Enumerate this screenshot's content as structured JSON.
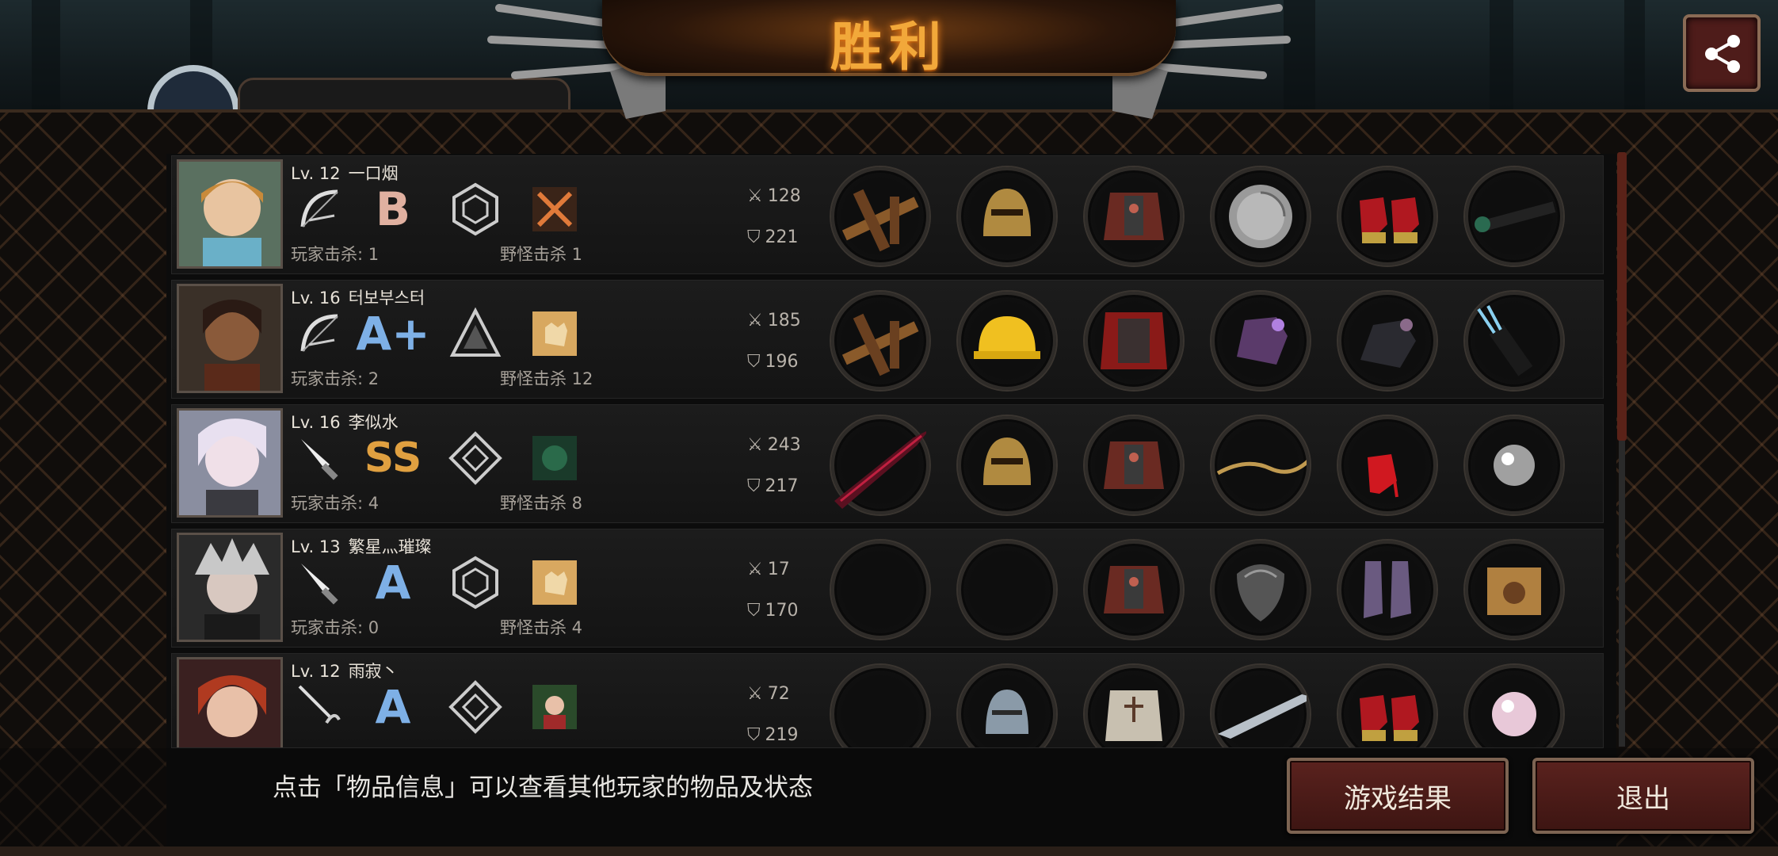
{
  "title": "胜利",
  "tip": "点击「物品信息」可以查看其他玩家的物品及状态",
  "buttons": {
    "game_result": "游戏结果",
    "exit": "退出"
  },
  "share_icon": "share-icon",
  "colors": {
    "title": "#f2a83a",
    "button_bg": "#4a1a17",
    "grade_gold": "#e0a040",
    "grade_blue": "#7eb0e6"
  },
  "players": [
    {
      "level": "Lv. 12",
      "name": "一口烟",
      "weapon_icon": "bow-icon",
      "grade": "B",
      "role_icon": "hexagon-emblem-icon",
      "skill_icon": "crossed-swords-skill-icon",
      "player_kills": "玩家击杀: 1",
      "monster_kills": "野怪击杀 1",
      "attack": "128",
      "defense": "221",
      "equipment": [
        "crossbow-icon",
        "gold-knight-helmet-icon",
        "red-plate-armor-icon",
        "silver-disc-icon",
        "red-heels-icon",
        "scope-icon"
      ]
    },
    {
      "level": "Lv. 16",
      "name": "터보부스터",
      "weapon_icon": "bow-icon",
      "grade": "A+",
      "role_icon": "triangle-emblem-icon",
      "skill_icon": "hand-skill-icon",
      "player_kills": "玩家击杀: 2",
      "monster_kills": "野怪击杀 12",
      "attack": "185",
      "defense": "196",
      "equipment": [
        "crossbow-icon",
        "hard-hat-icon",
        "red-cape-armor-icon",
        "purple-gauntlet-icon",
        "dark-gauntlet-icon",
        "quiver-icon"
      ]
    },
    {
      "level": "Lv. 16",
      "name": "李似水",
      "weapon_icon": "knife-icon",
      "grade": "SS",
      "role_icon": "diamond-emblem-icon",
      "skill_icon": "forest-skill-icon",
      "player_kills": "玩家击杀: 4",
      "monster_kills": "野怪击杀 8",
      "attack": "243",
      "defense": "217",
      "equipment": [
        "crimson-blade-icon",
        "gold-knight-helmet-icon",
        "red-plate-armor-icon",
        "golden-vine-icon",
        "red-heels-icon",
        "silver-orb-icon"
      ]
    },
    {
      "level": "Lv. 13",
      "name": "繁星灬璀璨",
      "weapon_icon": "knife-icon",
      "grade": "A",
      "role_icon": "hexagon-emblem-icon",
      "skill_icon": "hand-skill-icon",
      "player_kills": "玩家击杀: 0",
      "monster_kills": "野怪击杀 4",
      "attack": "17",
      "defense": "170",
      "equipment": [
        "empty-slot",
        "empty-slot",
        "red-plate-armor-icon",
        "steel-shield-icon",
        "purple-boots-icon",
        "cat-box-icon"
      ]
    },
    {
      "level": "Lv. 12",
      "name": "雨寂丶",
      "weapon_icon": "rapier-icon",
      "grade": "A",
      "role_icon": "diamond-emblem-icon",
      "skill_icon": "girl-portrait-skill-icon",
      "player_kills": "",
      "monster_kills": "",
      "attack": "72",
      "defense": "219",
      "equipment": [
        "empty-slot",
        "steel-helmet-icon",
        "white-plate-armor-icon",
        "feather-blade-icon",
        "red-heels-icon",
        "pearl-icon"
      ]
    }
  ]
}
